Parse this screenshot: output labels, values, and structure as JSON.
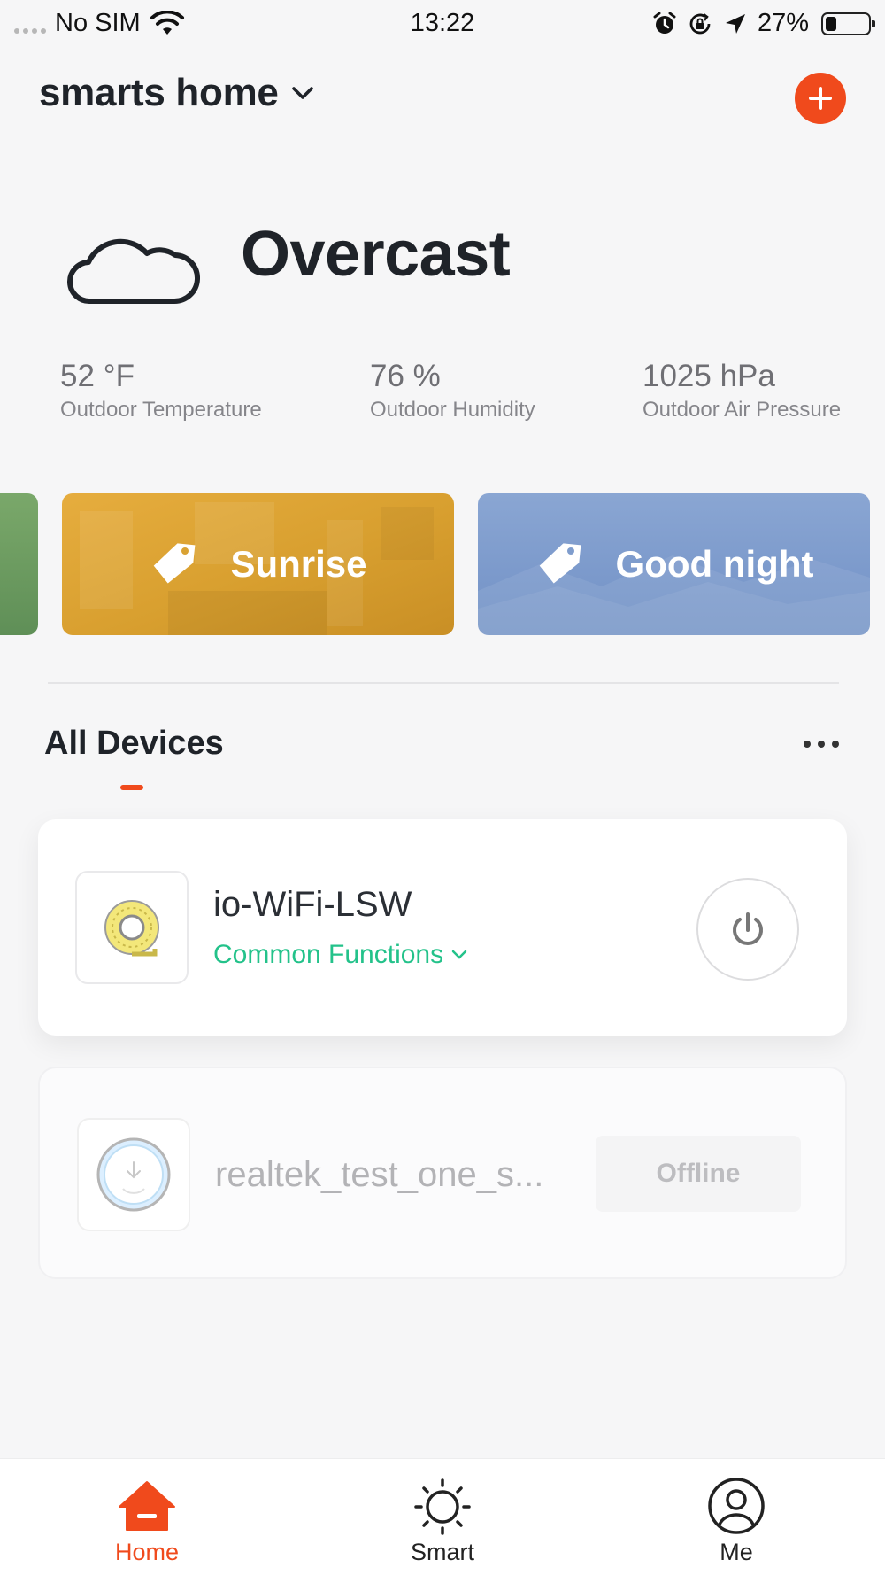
{
  "status_bar": {
    "carrier": "No SIM",
    "time": "13:22",
    "battery": "27%",
    "battery_level": 0.27
  },
  "header": {
    "home_name": "smarts home",
    "icons": {
      "dropdown": "chevron-down-icon",
      "add": "plus-icon"
    }
  },
  "weather": {
    "condition": "Overcast",
    "icon": "cloud-icon",
    "stats": [
      {
        "value": "52 °F",
        "label": "Outdoor Temperature"
      },
      {
        "value": "76 %",
        "label": "Outdoor Humidity"
      },
      {
        "value": "1025 hPa",
        "label": "Outdoor Air Pressure"
      }
    ]
  },
  "scenes": [
    {
      "label": "Sunrise",
      "icon": "tag-icon",
      "color": "#e0a638"
    },
    {
      "label": "Good night",
      "icon": "tag-icon",
      "color": "#7f9dcd"
    }
  ],
  "devices_section": {
    "tab_label": "All Devices",
    "more_icon": "more-dots-icon"
  },
  "devices": [
    {
      "name": "io-WiFi-LSW",
      "action_label": "Common Functions",
      "icon": "light-strip-icon",
      "control": "power-icon"
    },
    {
      "name": "realtek_test_one_s...",
      "status": "Offline",
      "icon": "smart-plug-icon"
    }
  ],
  "bottom_nav": {
    "items": [
      {
        "label": "Home",
        "icon": "home-icon",
        "active": true
      },
      {
        "label": "Smart",
        "icon": "sun-icon",
        "active": false
      },
      {
        "label": "Me",
        "icon": "user-icon",
        "active": false
      }
    ]
  },
  "colors": {
    "accent": "#f04a1c",
    "link_green": "#23c28a",
    "background": "#f6f6f7"
  }
}
